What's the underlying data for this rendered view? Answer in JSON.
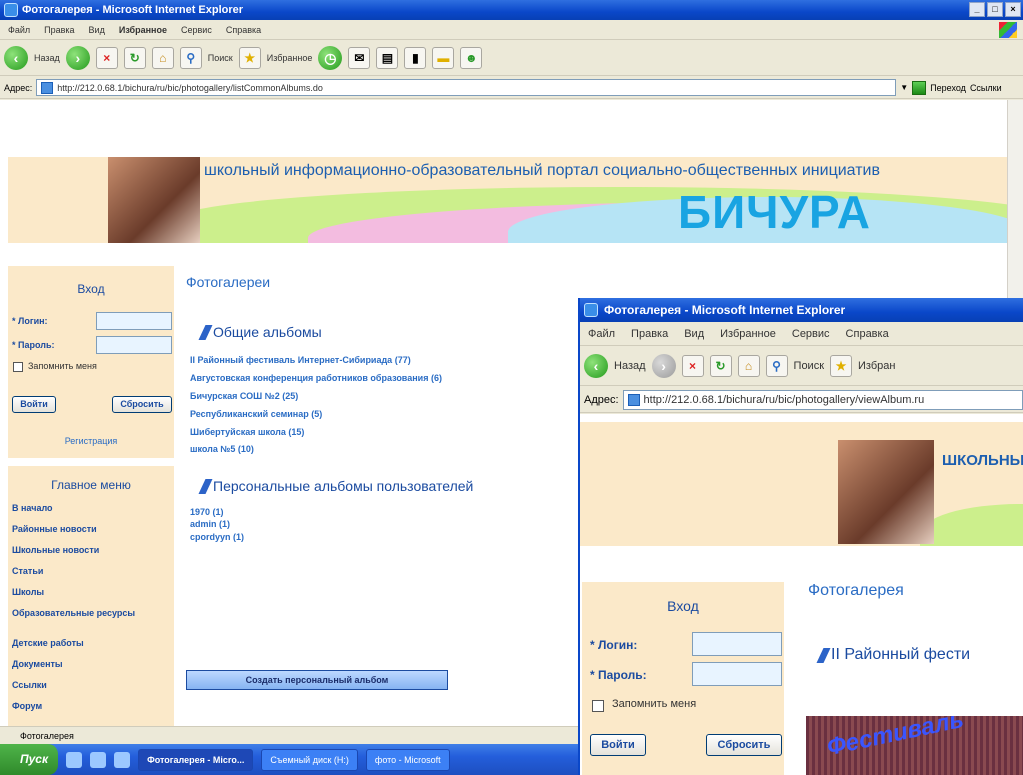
{
  "win1": {
    "title": "Фотогалерея - Microsoft Internet Explorer",
    "menu": [
      "Файл",
      "Правка",
      "Вид",
      "Избранное",
      "Сервис",
      "Справка"
    ],
    "toolbar": {
      "back": "Назад",
      "search": "Поиск",
      "favorites": "Избранное"
    },
    "address_label": "Адрес:",
    "address_value": "http://212.0.68.1/bichura/ru/bic/photogallery/listCommonAlbums.do",
    "goto_label": "Переход",
    "links_label": "Ссылки",
    "status": "Фотогалерея"
  },
  "page1": {
    "banner_text": "школьный информационно-образовательный портал социально-общественных инициатив",
    "banner_logo": "БИЧУРА",
    "login": {
      "title": "Вход",
      "login_label": "* Логин:",
      "password_label": "* Пароль:",
      "remember": "Запомнить меня",
      "enter": "Войти",
      "reset": "Сбросить",
      "register": "Регистрация"
    },
    "menu": {
      "title": "Главное меню",
      "items": [
        "В начало",
        "Районные новости",
        "Школьные новости",
        "Статьи",
        "Школы",
        "Образовательные ресурсы",
        "Детские работы",
        "Документы",
        "Ссылки",
        "Форум"
      ]
    },
    "heading": "Фотогалереи",
    "common_title": "Общие альбомы",
    "common_albums": [
      "II Районный фестиваль Интернет-Сибириада (77)",
      "Августовская конференция работников образования (6)",
      "Бичурская СОШ №2 (25)",
      "Республиканский семинар (5)",
      "Шибертуйская школа (15)",
      "школа №5 (10)"
    ],
    "personal_title": "Персональные альбомы пользователей",
    "personal_albums": [
      "1970 (1)",
      "admin (1)",
      "cpordyyn (1)"
    ],
    "create_button": "Создать персональный альбом"
  },
  "taskbar": {
    "start": "Пуск",
    "tasks": [
      "Фотогалерея - Micro...",
      "Съемный диск (H:)",
      "фото - Microsoft"
    ]
  },
  "win2": {
    "title": "Фотогалерея - Microsoft Internet Explorer",
    "menu": [
      "Файл",
      "Правка",
      "Вид",
      "Избранное",
      "Сервис",
      "Справка"
    ],
    "toolbar": {
      "back": "Назад",
      "search": "Поиск",
      "favorites": "Избран"
    },
    "address_label": "Адрес:",
    "address_value": "http://212.0.68.1/bichura/ru/bic/photogallery/viewAlbum.ru"
  },
  "page2": {
    "banner_text": "ШКОЛЬНЫ",
    "login": {
      "title": "Вход",
      "login_label": "* Логин:",
      "password_label": "* Пароль:",
      "remember": "Запомнить меня",
      "enter": "Войти",
      "reset": "Сбросить"
    },
    "heading": "Фотогалерея",
    "album_title": "II Районный фести",
    "image_caption": "Фестиваль"
  }
}
